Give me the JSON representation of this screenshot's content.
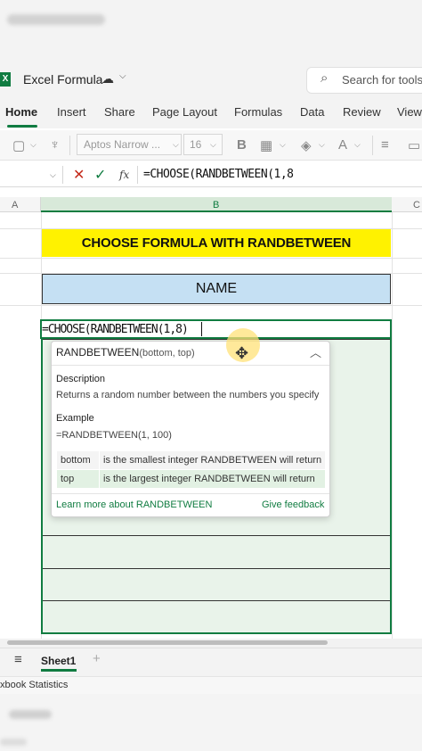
{
  "window": {
    "doc_title": "Excel Formula",
    "app_icon_letter": "X",
    "search_placeholder": "Search for tools"
  },
  "ribbon": {
    "tabs": [
      "Home",
      "Insert",
      "Share",
      "Page Layout",
      "Formulas",
      "Data",
      "Review",
      "View"
    ],
    "active_tab": "Home"
  },
  "toolbar": {
    "font_name": "Aptos Narrow ...",
    "font_size": "16",
    "bold_label": "B"
  },
  "formula_bar": {
    "fx_label": "fx",
    "formula": "=CHOOSE(RANDBETWEEN(1,8"
  },
  "columns": [
    "A",
    "B",
    "C"
  ],
  "sheet_cells": {
    "title": "CHOOSE FORMULA WITH RANDBETWEEN",
    "header": "NAME",
    "editing": "=CHOOSE(RANDBETWEEN(1,8)"
  },
  "tooltip": {
    "func_name": "RANDBETWEEN",
    "func_args": "(bottom, top)",
    "description_heading": "Description",
    "description": "Returns a random number between the numbers you specify",
    "example_heading": "Example",
    "example": "=RANDBETWEEN(1, 100)",
    "args": [
      {
        "name": "bottom",
        "desc": "is the smallest integer RANDBETWEEN will return"
      },
      {
        "name": "top",
        "desc": "is the largest integer RANDBETWEEN will return"
      }
    ],
    "learn_more": "Learn more about RANDBETWEEN",
    "feedback": "Give feedback"
  },
  "sheets": {
    "active": "Sheet1",
    "add_label": "+"
  },
  "status_bar": {
    "text": "xbook Statistics"
  },
  "colors": {
    "accent": "#107c41",
    "title_fill": "#fff200",
    "header_fill": "#c5e0f3",
    "range_fill": "#e9f3ea"
  }
}
